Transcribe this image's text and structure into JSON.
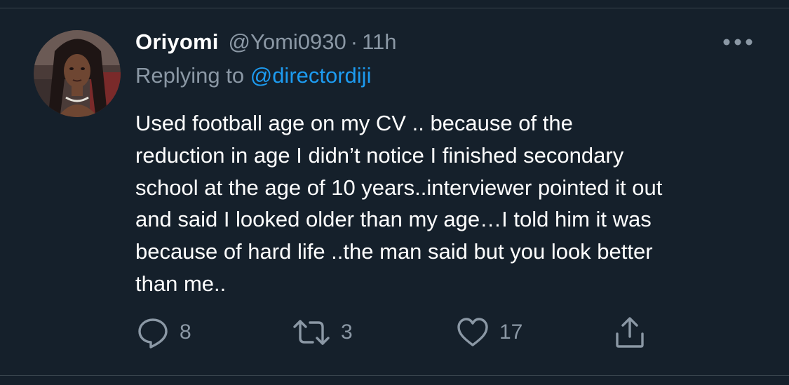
{
  "tweet": {
    "author_name": "Oriyomi",
    "author_handle": "@Yomi0930",
    "separator": "·",
    "time": "11h",
    "replying_prefix": "Replying to",
    "replying_to": "@directordiji",
    "text": "Used football age on my CV .. because of the\nreduction in age I didn’t notice I finished secondary\nschool at the age of 10 years..interviewer pointed it out\nand said I looked older than my age…I told him it was\nbecause of hard life ..the man said but you look better\nthan me..",
    "actions": {
      "reply_count": "8",
      "retweet_count": "3",
      "like_count": "17"
    }
  },
  "colors": {
    "background": "#15202b",
    "primary_text": "#ffffff",
    "secondary_text": "#8b98a5",
    "link": "#1d9bf0"
  },
  "icons": {
    "more": "more-horizontal-icon",
    "reply": "reply-bubble-icon",
    "retweet": "retweet-icon",
    "like": "heart-icon",
    "share": "share-upload-icon"
  }
}
